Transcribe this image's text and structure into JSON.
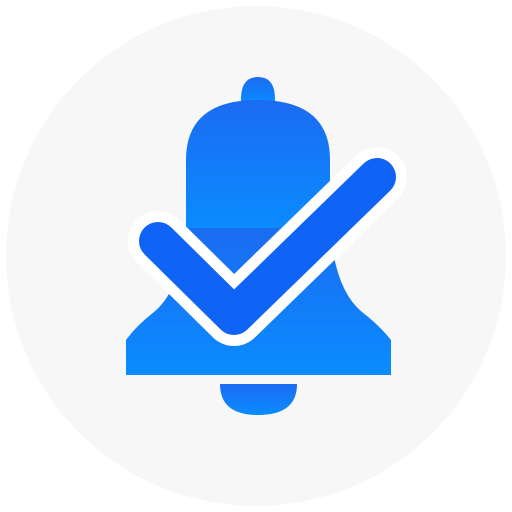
{
  "icon": {
    "name": "bell-check-icon",
    "background_color": "#f7f7f7",
    "bell_color_top": "#1b6cf0",
    "bell_color_bottom": "#0a8cff",
    "check_color": "#0f63f5",
    "check_outline_color": "#ffffff"
  }
}
